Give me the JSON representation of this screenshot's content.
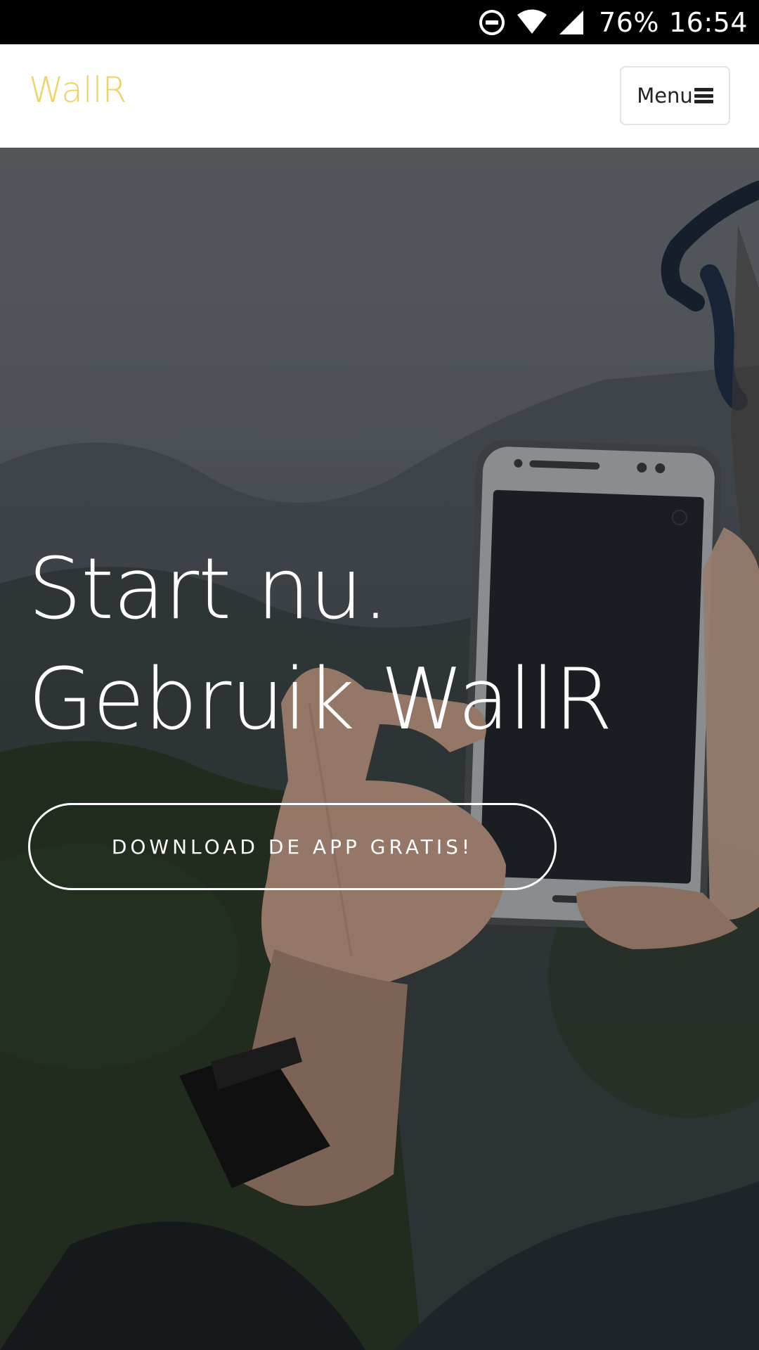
{
  "status_bar": {
    "icons": [
      "do-not-disturb-icon",
      "wifi-icon",
      "cell-signal-icon"
    ],
    "battery": "76%",
    "time": "16:54"
  },
  "navbar": {
    "brand": "WallR",
    "menu_label": "Menu",
    "menu_icon": "hamburger-icon",
    "brand_color": "#f0d264"
  },
  "hero": {
    "title_line1": "Start nu.",
    "title_line2": "Gebruik WallR",
    "cta_label": "DOWNLOAD DE APP GRATIS!",
    "background_image": "person-holding-smartphone-mountain-landscape"
  }
}
